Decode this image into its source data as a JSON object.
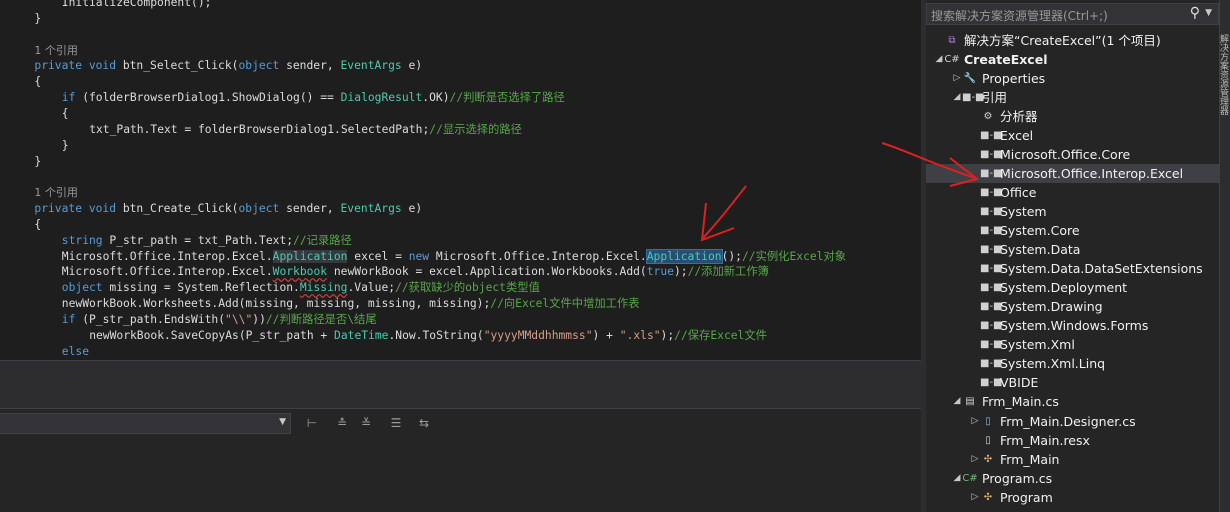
{
  "editor": {
    "lines": [
      {
        "indent": 8,
        "parts": [
          {
            "t": "InitializeComponent();"
          }
        ]
      },
      {
        "indent": 4,
        "parts": [
          {
            "t": "}"
          }
        ]
      },
      {
        "indent": 0,
        "parts": []
      },
      {
        "indent": 4,
        "parts": [
          {
            "c": "refcount",
            "t": "1 个引用"
          }
        ]
      },
      {
        "indent": 4,
        "parts": [
          {
            "c": "kw",
            "t": "private"
          },
          {
            "t": " "
          },
          {
            "c": "kw",
            "t": "void"
          },
          {
            "t": " btn_Select_Click("
          },
          {
            "c": "kw",
            "t": "object"
          },
          {
            "t": " sender, "
          },
          {
            "c": "ty",
            "t": "EventArgs"
          },
          {
            "t": " e)"
          }
        ]
      },
      {
        "indent": 4,
        "parts": [
          {
            "t": "{"
          }
        ]
      },
      {
        "indent": 8,
        "parts": [
          {
            "c": "kw",
            "t": "if"
          },
          {
            "t": " (folderBrowserDialog1.ShowDialog() == "
          },
          {
            "c": "ty",
            "t": "DialogResult"
          },
          {
            "t": ".OK)"
          },
          {
            "c": "cm",
            "t": "//判断是否选择了路径"
          }
        ]
      },
      {
        "indent": 8,
        "parts": [
          {
            "t": "{"
          }
        ]
      },
      {
        "indent": 12,
        "parts": [
          {
            "t": "txt_Path.Text = folderBrowserDialog1.SelectedPath;"
          },
          {
            "c": "cm",
            "t": "//显示选择的路径"
          }
        ]
      },
      {
        "indent": 8,
        "parts": [
          {
            "t": "}"
          }
        ]
      },
      {
        "indent": 4,
        "parts": [
          {
            "t": "}"
          }
        ]
      },
      {
        "indent": 0,
        "parts": []
      },
      {
        "indent": 4,
        "parts": [
          {
            "c": "refcount",
            "t": "1 个引用"
          }
        ]
      },
      {
        "indent": 4,
        "parts": [
          {
            "c": "kw",
            "t": "private"
          },
          {
            "t": " "
          },
          {
            "c": "kw",
            "t": "void"
          },
          {
            "t": " btn_Create_Click("
          },
          {
            "c": "kw",
            "t": "object"
          },
          {
            "t": " sender, "
          },
          {
            "c": "ty",
            "t": "EventArgs"
          },
          {
            "t": " e)"
          }
        ]
      },
      {
        "indent": 4,
        "parts": [
          {
            "t": "{"
          }
        ]
      },
      {
        "indent": 8,
        "parts": [
          {
            "c": "kw",
            "t": "string"
          },
          {
            "t": " P_str_path = txt_Path.Text;"
          },
          {
            "c": "cm",
            "t": "//记录路径"
          }
        ]
      },
      {
        "indent": 8,
        "parts": [
          {
            "t": "Microsoft.Office.Interop.Excel."
          },
          {
            "c": "ty hl2",
            "t": "Application"
          },
          {
            "t": " excel = "
          },
          {
            "c": "kw",
            "t": "new"
          },
          {
            "t": " Microsoft.Office.Interop.Excel."
          },
          {
            "c": "ty hl",
            "t": "Application"
          },
          {
            "t": "();"
          },
          {
            "c": "cm",
            "t": "//实例化Excel对象"
          }
        ]
      },
      {
        "indent": 8,
        "parts": [
          {
            "t": "Microsoft.Office.Interop.Excel."
          },
          {
            "c": "ty squig",
            "t": "Workbook"
          },
          {
            "t": " newWorkBook = excel.Application.Workbooks.Add("
          },
          {
            "c": "kw",
            "t": "true"
          },
          {
            "t": ");"
          },
          {
            "c": "cm",
            "t": "//添加新工作簿"
          }
        ]
      },
      {
        "indent": 8,
        "parts": [
          {
            "c": "kw",
            "t": "object"
          },
          {
            "t": " missing = System.Reflection."
          },
          {
            "c": "ty squig",
            "t": "Missing"
          },
          {
            "t": ".Value;"
          },
          {
            "c": "cm",
            "t": "//获取缺少的object类型值"
          }
        ]
      },
      {
        "indent": 8,
        "parts": [
          {
            "t": "newWorkBook.Worksheets.Add(missing, missing, missing, missing);"
          },
          {
            "c": "cm",
            "t": "//向Excel文件中增加工作表"
          }
        ]
      },
      {
        "indent": 8,
        "parts": [
          {
            "c": "kw",
            "t": "if"
          },
          {
            "t": " (P_str_path.EndsWith("
          },
          {
            "c": "st",
            "t": "\"\\\\\""
          },
          {
            "t": "))"
          },
          {
            "c": "cm",
            "t": "//判断路径是否\\结尾"
          }
        ]
      },
      {
        "indent": 12,
        "parts": [
          {
            "t": "newWorkBook.SaveCopyAs(P_str_path + "
          },
          {
            "c": "ty",
            "t": "DateTime"
          },
          {
            "t": ".Now.ToString("
          },
          {
            "c": "st",
            "t": "\"yyyyMMddhhmmss\""
          },
          {
            "t": ") + "
          },
          {
            "c": "st",
            "t": "\".xls\""
          },
          {
            "t": ");"
          },
          {
            "c": "cm",
            "t": "//保存Excel文件"
          }
        ]
      },
      {
        "indent": 8,
        "parts": [
          {
            "c": "kw",
            "t": "else"
          }
        ]
      }
    ]
  },
  "solution_explorer": {
    "search_placeholder": "搜索解决方案资源管理器(Ctrl+;)",
    "items": [
      {
        "label": "解决方案“CreateExcel”(1 个项目)",
        "level": 0,
        "icon": "solution-icon",
        "twisty": "",
        "bold": false
      },
      {
        "label": "CreateExcel",
        "level": 0,
        "icon": "csharp-project-icon",
        "twisty": "expanded",
        "bold": true
      },
      {
        "label": "Properties",
        "level": 1,
        "icon": "wrench-icon",
        "twisty": "collapsed",
        "bold": false
      },
      {
        "label": "引用",
        "level": 1,
        "icon": "references-icon",
        "twisty": "expanded",
        "bold": false
      },
      {
        "label": "分析器",
        "level": 2,
        "icon": "analyzer-icon",
        "twisty": "",
        "bold": false
      },
      {
        "label": "Excel",
        "level": 2,
        "icon": "reference-icon",
        "twisty": "",
        "bold": false
      },
      {
        "label": "Microsoft.Office.Core",
        "level": 2,
        "icon": "reference-icon",
        "twisty": "",
        "bold": false
      },
      {
        "label": "Microsoft.Office.Interop.Excel",
        "level": 2,
        "icon": "reference-icon",
        "twisty": "",
        "bold": false,
        "selected": true
      },
      {
        "label": "Office",
        "level": 2,
        "icon": "reference-icon",
        "twisty": "",
        "bold": false
      },
      {
        "label": "System",
        "level": 2,
        "icon": "reference-icon",
        "twisty": "",
        "bold": false
      },
      {
        "label": "System.Core",
        "level": 2,
        "icon": "reference-icon",
        "twisty": "",
        "bold": false
      },
      {
        "label": "System.Data",
        "level": 2,
        "icon": "reference-icon",
        "twisty": "",
        "bold": false
      },
      {
        "label": "System.Data.DataSetExtensions",
        "level": 2,
        "icon": "reference-icon",
        "twisty": "",
        "bold": false
      },
      {
        "label": "System.Deployment",
        "level": 2,
        "icon": "reference-icon",
        "twisty": "",
        "bold": false
      },
      {
        "label": "System.Drawing",
        "level": 2,
        "icon": "reference-icon",
        "twisty": "",
        "bold": false
      },
      {
        "label": "System.Windows.Forms",
        "level": 2,
        "icon": "reference-icon",
        "twisty": "",
        "bold": false
      },
      {
        "label": "System.Xml",
        "level": 2,
        "icon": "reference-icon",
        "twisty": "",
        "bold": false
      },
      {
        "label": "System.Xml.Linq",
        "level": 2,
        "icon": "reference-icon",
        "twisty": "",
        "bold": false
      },
      {
        "label": "VBIDE",
        "level": 2,
        "icon": "reference-icon",
        "twisty": "",
        "bold": false
      },
      {
        "label": "Frm_Main.cs",
        "level": 1,
        "icon": "form-icon",
        "twisty": "expanded",
        "bold": false
      },
      {
        "label": "Frm_Main.Designer.cs",
        "level": 2,
        "icon": "cs-file-icon",
        "twisty": "collapsed",
        "bold": false
      },
      {
        "label": "Frm_Main.resx",
        "level": 2,
        "icon": "resx-file-icon",
        "twisty": "",
        "bold": false
      },
      {
        "label": "Frm_Main",
        "level": 2,
        "icon": "class-icon",
        "twisty": "collapsed",
        "bold": false
      },
      {
        "label": "Program.cs",
        "level": 1,
        "icon": "csharp-file-icon",
        "twisty": "expanded",
        "bold": false
      },
      {
        "label": "Program",
        "level": 2,
        "icon": "class-icon",
        "twisty": "collapsed",
        "bold": false
      }
    ]
  },
  "side_tab_label": "解决方案资源管理器",
  "colors": {
    "accent": "#3f3f46",
    "annotation": "#e02020",
    "keyword": "#569cd6",
    "type": "#4ec9b0",
    "comment": "#57a64a"
  }
}
